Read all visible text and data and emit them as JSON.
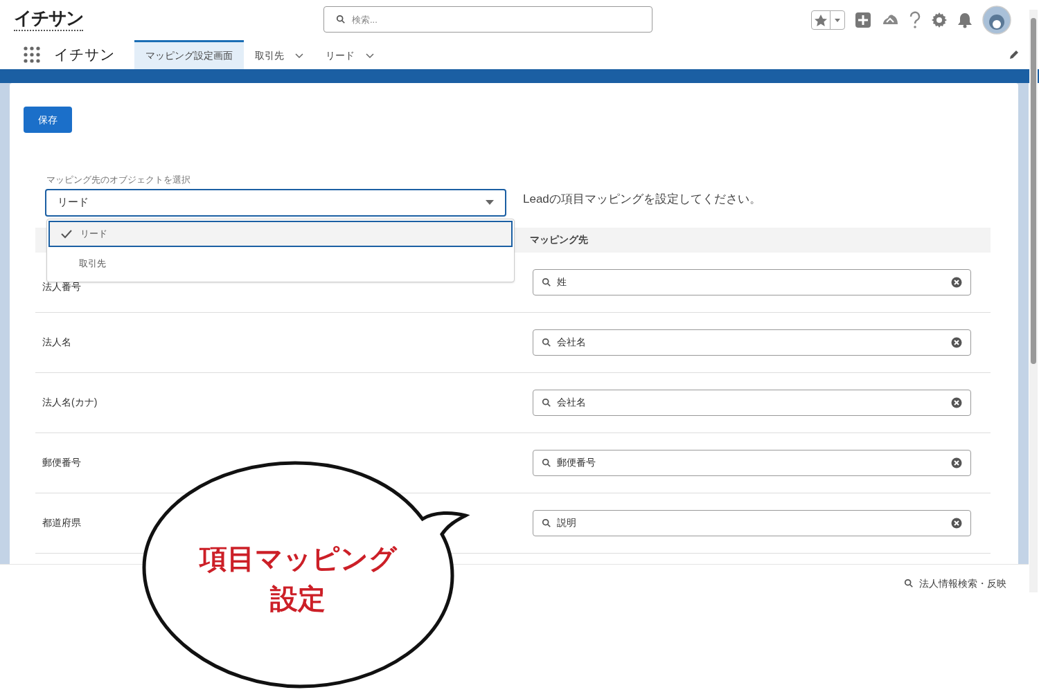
{
  "app": {
    "logo": "イチサン",
    "name": "イチサン"
  },
  "search": {
    "placeholder": "検索..."
  },
  "nav_tabs": [
    {
      "label": "マッピング設定画面",
      "selected": true,
      "dropdown": false
    },
    {
      "label": "取引先",
      "selected": false,
      "dropdown": true
    },
    {
      "label": "リード",
      "selected": false,
      "dropdown": true
    }
  ],
  "save_button": "保存",
  "object_select": {
    "label": "マッピング先のオブジェクトを選択",
    "value": "リード",
    "expanded": true,
    "options": [
      {
        "label": "リード",
        "selected": true
      },
      {
        "label": "取引先",
        "selected": false
      }
    ]
  },
  "instruction": "Leadの項目マッピングを設定してください。",
  "table": {
    "columns": [
      "マッピング先"
    ],
    "rows": [
      {
        "field": "法人番号",
        "mapping": "姓"
      },
      {
        "field": "法人名",
        "mapping": "会社名"
      },
      {
        "field": "法人名(カナ)",
        "mapping": "会社名"
      },
      {
        "field": "郵便番号",
        "mapping": "郵便番号"
      },
      {
        "field": "都道府県",
        "mapping": "説明"
      }
    ]
  },
  "utility_bar": {
    "label": "法人情報検索・反映"
  },
  "callout": {
    "lines": [
      "項目マッピング",
      "設定"
    ]
  }
}
